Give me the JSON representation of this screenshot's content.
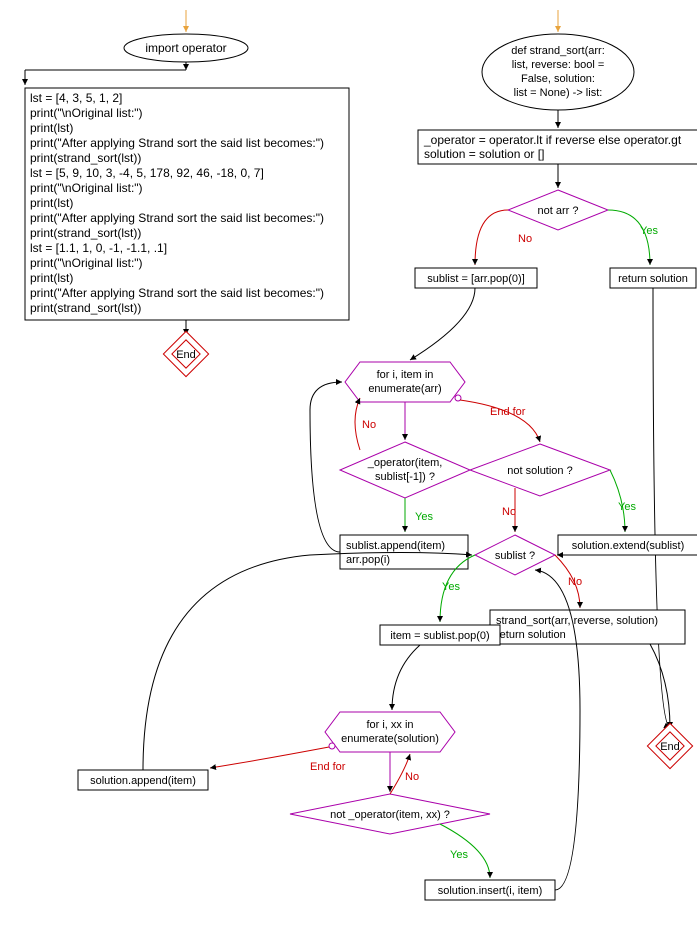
{
  "chart_data": {
    "type": "flowchart",
    "left_flow": {
      "start": "import operator",
      "main_block": [
        "lst = [4, 3, 5, 1, 2]",
        "print(\"\\nOriginal list:\")",
        "print(lst)",
        "print(\"After applying  Strand sort the said list becomes:\")",
        "print(strand_sort(lst))",
        "lst = [5, 9, 10, 3, -4, 5, 178, 92, 46, -18, 0, 7]",
        "print(\"\\nOriginal list:\")",
        "print(lst)",
        "print(\"After applying Strand sort the said list becomes:\")",
        "print(strand_sort(lst))",
        "lst = [1.1, 1, 0, -1, -1.1, .1]",
        "print(\"\\nOriginal list:\")",
        "print(lst)",
        "print(\"After applying Strand sort the said list becomes:\")",
        "print(strand_sort(lst))"
      ],
      "end": "End"
    },
    "right_flow": {
      "func_def": "def strand_sort(arr:\nlist, reverse: bool =\nFalse, solution:\nlist = None) -> list:",
      "assign": "_operator = operator.lt if reverse else operator.gt\nsolution = solution or []",
      "cond_not_arr": "not arr ?",
      "return_solution": "return solution",
      "sublist_assign": "sublist = [arr.pop(0)]",
      "for_loop1": "for i, item in\nenumerate(arr)",
      "cond_operator": "_operator(item,\nsublist[-1]) ?",
      "append_pop": "sublist.append(item)\narr.pop(i)",
      "cond_not_solution": "not solution ?",
      "solution_extend": "solution.extend(sublist)",
      "cond_sublist": "sublist ?",
      "recurse": "strand_sort(arr, reverse, solution)\nreturn solution",
      "item_pop": "item = sublist.pop(0)",
      "for_loop2": "for i, xx in\nenumerate(solution)",
      "cond_not_op": "not _operator(item, xx) ?",
      "solution_insert": "solution.insert(i, item)",
      "solution_append": "solution.append(item)",
      "end": "End"
    },
    "edge_labels": {
      "yes": "Yes",
      "no": "No",
      "endfor": "End for"
    }
  }
}
